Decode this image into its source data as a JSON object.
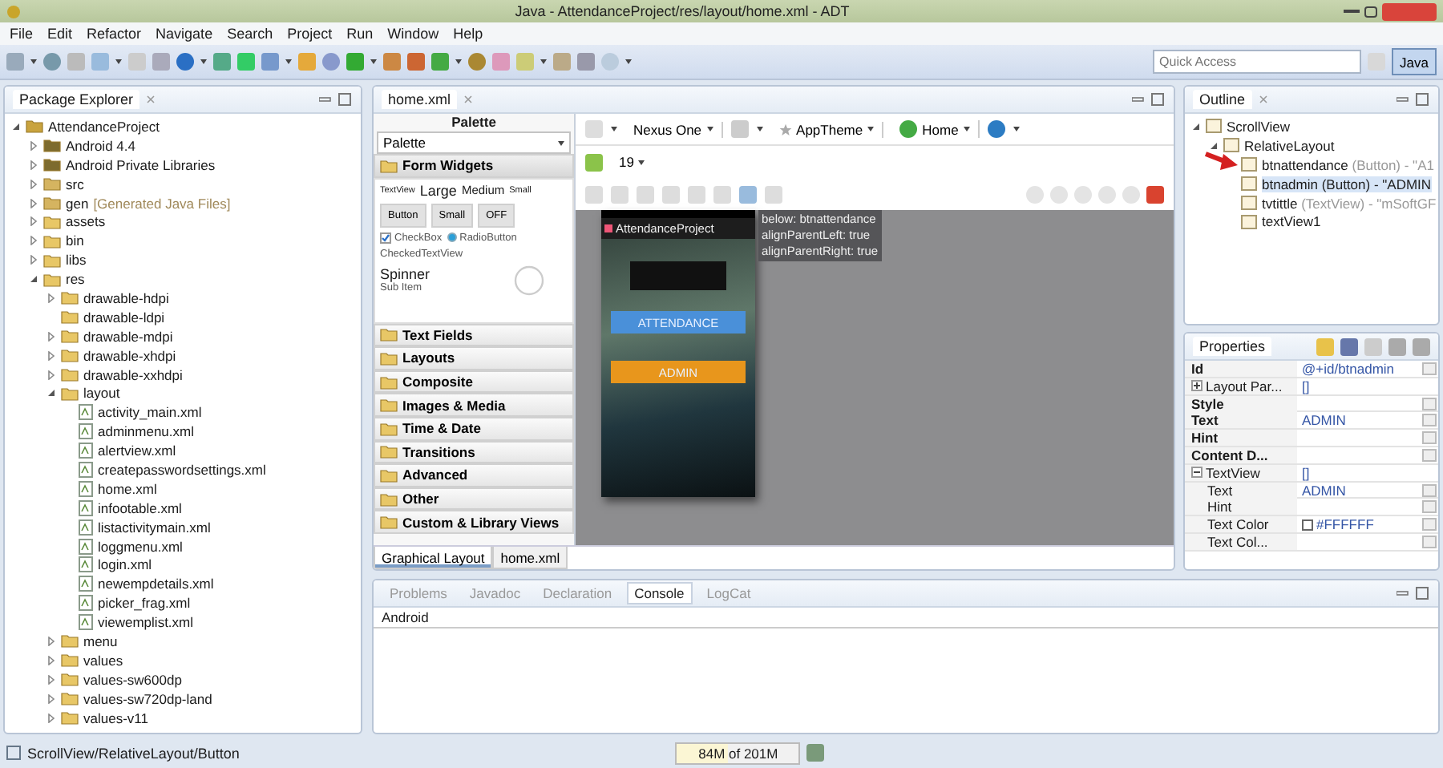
{
  "window": {
    "title": "Java - AttendanceProject/res/layout/home.xml - ADT"
  },
  "menu": [
    "File",
    "Edit",
    "Refactor",
    "Navigate",
    "Search",
    "Project",
    "Run",
    "Window",
    "Help"
  ],
  "quick_access": {
    "placeholder": "Quick Access"
  },
  "perspective": {
    "label": "Java",
    "selected": true
  },
  "package_explorer": {
    "title": "Package Explorer",
    "tree": [
      {
        "label": "AttendanceProject",
        "kind": "project",
        "expanded": true,
        "children": [
          {
            "label": "Android 4.4",
            "kind": "library",
            "expanded": false
          },
          {
            "label": "Android Private Libraries",
            "kind": "library",
            "expanded": false
          },
          {
            "label": "src",
            "kind": "source",
            "expanded": false
          },
          {
            "label": "gen",
            "note": "[Generated Java Files]",
            "kind": "source",
            "expanded": false
          },
          {
            "label": "assets",
            "kind": "folder",
            "expanded": false
          },
          {
            "label": "bin",
            "kind": "folder",
            "expanded": false
          },
          {
            "label": "libs",
            "kind": "folder",
            "expanded": false
          },
          {
            "label": "res",
            "kind": "folder",
            "expanded": true,
            "children": [
              {
                "label": "drawable-hdpi",
                "kind": "folder",
                "expanded": false
              },
              {
                "label": "drawable-ldpi",
                "kind": "folder"
              },
              {
                "label": "drawable-mdpi",
                "kind": "folder",
                "expanded": false
              },
              {
                "label": "drawable-xhdpi",
                "kind": "folder",
                "expanded": false
              },
              {
                "label": "drawable-xxhdpi",
                "kind": "folder",
                "expanded": false
              },
              {
                "label": "layout",
                "kind": "folder",
                "expanded": true,
                "children": [
                  {
                    "label": "activity_main.xml",
                    "kind": "file"
                  },
                  {
                    "label": "adminmenu.xml",
                    "kind": "file"
                  },
                  {
                    "label": "alertview.xml",
                    "kind": "file"
                  },
                  {
                    "label": "createpasswordsettings.xml",
                    "kind": "file"
                  },
                  {
                    "label": "home.xml",
                    "kind": "file"
                  },
                  {
                    "label": "infootable.xml",
                    "kind": "file"
                  },
                  {
                    "label": "listactivitymain.xml",
                    "kind": "file"
                  },
                  {
                    "label": "loggmenu.xml",
                    "kind": "file"
                  },
                  {
                    "label": "login.xml",
                    "kind": "file"
                  },
                  {
                    "label": "newempdetails.xml",
                    "kind": "file"
                  },
                  {
                    "label": "picker_frag.xml",
                    "kind": "file"
                  },
                  {
                    "label": "viewemplist.xml",
                    "kind": "file"
                  }
                ]
              },
              {
                "label": "menu",
                "kind": "folder",
                "expanded": false
              },
              {
                "label": "values",
                "kind": "folder",
                "expanded": false
              },
              {
                "label": "values-sw600dp",
                "kind": "folder",
                "expanded": false
              },
              {
                "label": "values-sw720dp-land",
                "kind": "folder",
                "expanded": false
              },
              {
                "label": "values-v11",
                "kind": "folder",
                "expanded": false
              }
            ]
          }
        ]
      }
    ]
  },
  "editor": {
    "tab": "home.xml",
    "palette": {
      "title": "Palette",
      "dropdown": "Palette",
      "categories": [
        {
          "label": "Form Widgets",
          "expanded": true
        },
        {
          "label": "Text Fields",
          "expanded": false
        },
        {
          "label": "Layouts",
          "expanded": false
        },
        {
          "label": "Composite",
          "expanded": false
        },
        {
          "label": "Images & Media",
          "expanded": false
        },
        {
          "label": "Time & Date",
          "expanded": false
        },
        {
          "label": "Transitions",
          "expanded": false
        },
        {
          "label": "Advanced",
          "expanded": false
        },
        {
          "label": "Other",
          "expanded": false
        },
        {
          "label": "Custom & Library Views",
          "expanded": false
        }
      ],
      "widgets": {
        "text_sizes": [
          "TextView",
          "Large",
          "Medium",
          "Small"
        ],
        "buttons": [
          "Button",
          "Small",
          "OFF"
        ],
        "checkbox": {
          "label": "CheckBox",
          "checked": true
        },
        "radio": {
          "label": "RadioButton",
          "selected": true
        },
        "checked_text": "CheckedTextView",
        "spinner": "Spinner",
        "spinner_sub": "Sub Item"
      }
    },
    "canvas": {
      "device": "Nexus One",
      "theme": "AppTheme",
      "activity": "Home",
      "api": "19",
      "tooltip": [
        "below: btnattendance",
        "alignParentLeft: true",
        "alignParentRight: true"
      ],
      "phone": {
        "app_title": "AttendanceProject",
        "buttons": [
          {
            "label": "ATTENDANCE",
            "color": "#4a90d9"
          },
          {
            "label": "ADMIN",
            "color": "#e8961c"
          }
        ]
      }
    },
    "bottom_tabs": [
      {
        "label": "Graphical Layout",
        "selected": true
      },
      {
        "label": "home.xml",
        "selected": false
      }
    ]
  },
  "outline": {
    "title": "Outline",
    "tree": [
      {
        "label": "ScrollView",
        "expanded": true,
        "children": [
          {
            "label": "RelativeLayout",
            "expanded": true,
            "children": [
              {
                "label": "btnattendance",
                "type": "(Button) - \"A1",
                "selected": false
              },
              {
                "label": "btnadmin",
                "type": "(Button) - \"ADMIN",
                "selected": true
              },
              {
                "label": "tvtittle",
                "type": "(TextView) - \"mSoftGF",
                "selected": false
              },
              {
                "label": "textView1",
                "selected": false
              }
            ]
          }
        ]
      }
    ]
  },
  "properties": {
    "title": "Properties",
    "rows": [
      {
        "name": "Id",
        "value": "@+id/btnadmin",
        "kind": "prop"
      },
      {
        "name": "Layout Par...",
        "value": "[]",
        "kind": "group",
        "expanded": false
      },
      {
        "name": "Style",
        "kind": "prop"
      },
      {
        "name": "Text",
        "value": "ADMIN",
        "kind": "prop"
      },
      {
        "name": "Hint",
        "kind": "prop"
      },
      {
        "name": "Content D...",
        "kind": "prop"
      },
      {
        "name": "TextView",
        "value": "[]",
        "kind": "group",
        "expanded": true
      },
      {
        "name": "Text",
        "value": "ADMIN",
        "kind": "sub"
      },
      {
        "name": "Hint",
        "kind": "sub"
      },
      {
        "name": "Text Color",
        "value": "#FFFFFF",
        "kind": "color"
      },
      {
        "name": "Text Col...",
        "kind": "sub"
      }
    ]
  },
  "console": {
    "tabs": [
      {
        "label": "Problems",
        "selected": false
      },
      {
        "label": "Javadoc",
        "selected": false
      },
      {
        "label": "Declaration",
        "selected": false
      },
      {
        "label": "Console",
        "selected": true
      },
      {
        "label": "LogCat",
        "selected": false
      }
    ],
    "header": "Android"
  },
  "status_bar": {
    "path": "ScrollView/RelativeLayout/Button",
    "memory": {
      "text": "84M of 201M",
      "level": 0.42
    }
  }
}
